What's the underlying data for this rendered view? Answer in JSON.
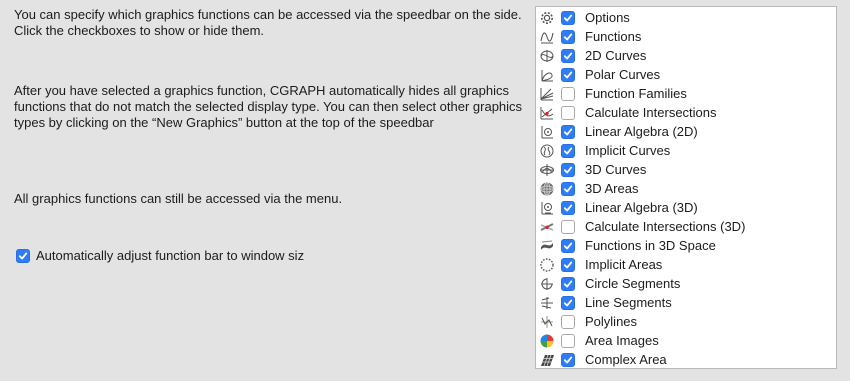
{
  "left": {
    "paragraph1": "You can specify which graphics functions can be accessed via the speedbar on the side. Click the checkboxes to show or hide them.",
    "paragraph2": "After you have selected a graphics function, CGRAPH automatically hides all graphics functions that do not match the selected display type. You can then select other graphics types by clicking on the “New Graphics” button at the top of the speedbar",
    "paragraph3": "All graphics functions can still be accessed via the menu.",
    "auto_adjust_label": "Automatically adjust function bar to window siz",
    "auto_adjust_checked": true
  },
  "functions": [
    {
      "label": "Options",
      "checked": true,
      "icon": "gear-icon"
    },
    {
      "label": "Functions",
      "checked": true,
      "icon": "function-curve-icon"
    },
    {
      "label": "2D Curves",
      "checked": true,
      "icon": "2d-curve-icon"
    },
    {
      "label": "Polar Curves",
      "checked": true,
      "icon": "polar-curve-icon"
    },
    {
      "label": "Function Families",
      "checked": false,
      "icon": "function-family-icon"
    },
    {
      "label": "Calculate Intersections",
      "checked": false,
      "icon": "intersection-icon"
    },
    {
      "label": "Linear Algebra (2D)",
      "checked": true,
      "icon": "linear-algebra-2d-icon"
    },
    {
      "label": "Implicit Curves",
      "checked": true,
      "icon": "implicit-curve-icon"
    },
    {
      "label": "3D Curves",
      "checked": true,
      "icon": "3d-curve-icon"
    },
    {
      "label": "3D Areas",
      "checked": true,
      "icon": "3d-area-icon"
    },
    {
      "label": "Linear Algebra (3D)",
      "checked": true,
      "icon": "linear-algebra-3d-icon"
    },
    {
      "label": "Calculate Intersections (3D)",
      "checked": false,
      "icon": "intersection-3d-icon"
    },
    {
      "label": "Functions in 3D Space",
      "checked": true,
      "icon": "function-3d-icon"
    },
    {
      "label": "Implicit Areas",
      "checked": true,
      "icon": "implicit-area-icon"
    },
    {
      "label": "Circle Segments",
      "checked": true,
      "icon": "circle-segment-icon"
    },
    {
      "label": "Line Segments",
      "checked": true,
      "icon": "line-segment-icon"
    },
    {
      "label": "Polylines",
      "checked": false,
      "icon": "polyline-icon"
    },
    {
      "label": "Area Images",
      "checked": false,
      "icon": "color-wheel-icon"
    },
    {
      "label": "Complex Area",
      "checked": true,
      "icon": "complex-area-icon"
    }
  ]
}
